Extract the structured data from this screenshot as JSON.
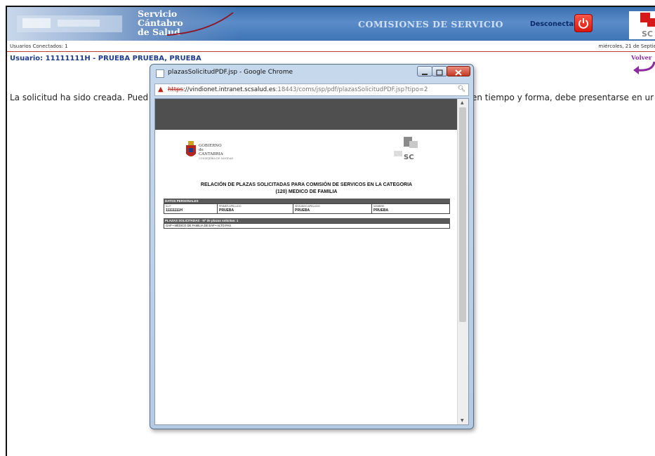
{
  "header": {
    "logo_lines": [
      "Servicio",
      "Cántabro",
      "de Salud"
    ],
    "app_title": "COMISIONES DE SERVICIO",
    "logout_label": "Desconectar",
    "accent": "#3a6fb0"
  },
  "status": {
    "users_online": "Usuarios Conectados: 1",
    "date": "miércoles, 21 de Septie"
  },
  "user_line": "Usuario: 11111111H - PRUEBA PRUEBA, PRUEBA",
  "back_label": "Volver",
  "message_left": "La solicitud ha sido creada. Pued",
  "message_right": "en tiempo y forma, debe presentarse en ur",
  "popup": {
    "title": "plazasSolicitudPDF.jsp - Google Chrome",
    "url_scheme": "https",
    "url_host": "://vindionet.intranet.scsalud.es",
    "url_rest": ":18443/coms/jsp/pdf/plazasSolicitudPDF.jsp?tipo=2",
    "pdf": {
      "gov_lines": [
        "GOBIERNO",
        "de",
        "CANTABRIA",
        "CONSEJERÍA DE SANIDAD"
      ],
      "title_line1": "RELACIÓN DE PLAZAS SOLICITADAS PARA COMISIÓN DE SERVICOS EN LA CATEGORIA",
      "title_line2": "(120) MEDICO DE FAMILIA",
      "section_personal": "DATOS PERSONALES",
      "personal": [
        {
          "header": "N.I.F.",
          "value": "11111111H"
        },
        {
          "header": "PRIMER APELLIDO",
          "value": "PRUEBA"
        },
        {
          "header": "SEGUNDO APELLIDO",
          "value": "PRUEBA"
        },
        {
          "header": "NOMBRE",
          "value": "PRUEBA"
        }
      ],
      "section_plazas": "PLAZAS SOLICITADAS - Nº de plazas solicitas: 1",
      "plaza_row": "GAP • MÉDICO DE FAMILIA DE EAP • ALTO PAS"
    }
  }
}
